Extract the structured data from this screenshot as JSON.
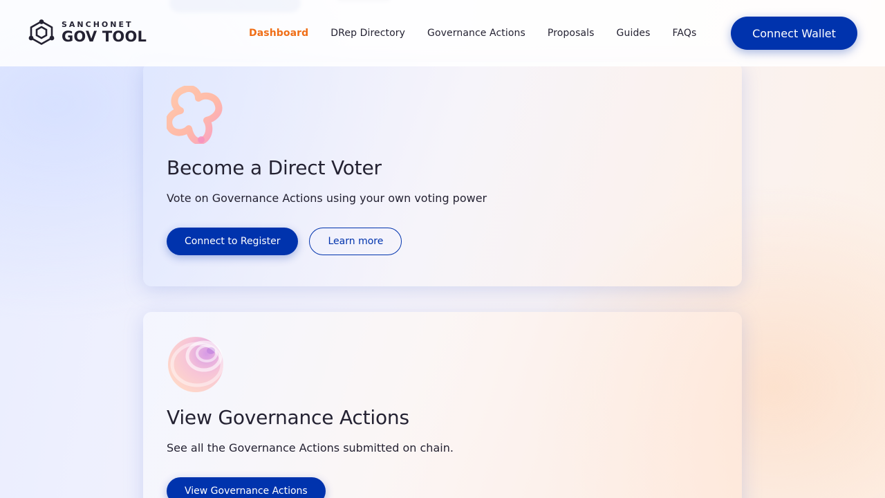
{
  "header": {
    "logo": {
      "small": "SANCHONET",
      "big": "GOV TOOL",
      "icon": "govtool-hexagon-icon"
    },
    "nav": [
      {
        "label": "Dashboard",
        "active": true
      },
      {
        "label": "DRep Directory",
        "active": false
      },
      {
        "label": "Governance Actions",
        "active": false
      },
      {
        "label": "Proposals",
        "active": false
      },
      {
        "label": "Guides",
        "active": false
      },
      {
        "label": "FAQs",
        "active": false
      }
    ],
    "connect_wallet_label": "Connect Wallet"
  },
  "cards": [
    {
      "icon": "star-shape-illustration",
      "title": "Become a Direct Voter",
      "description": "Vote on Governance Actions using your own voting power",
      "primary_label": "Connect to Register",
      "secondary_label": "Learn more"
    },
    {
      "icon": "sphere-illustration",
      "title": "View Governance Actions",
      "description": "See all the Governance Actions submitted on chain.",
      "primary_label": "View Governance Actions"
    }
  ],
  "colors": {
    "primary": "#0033ad",
    "active_nav": "#f06e17",
    "text": "#242232"
  }
}
